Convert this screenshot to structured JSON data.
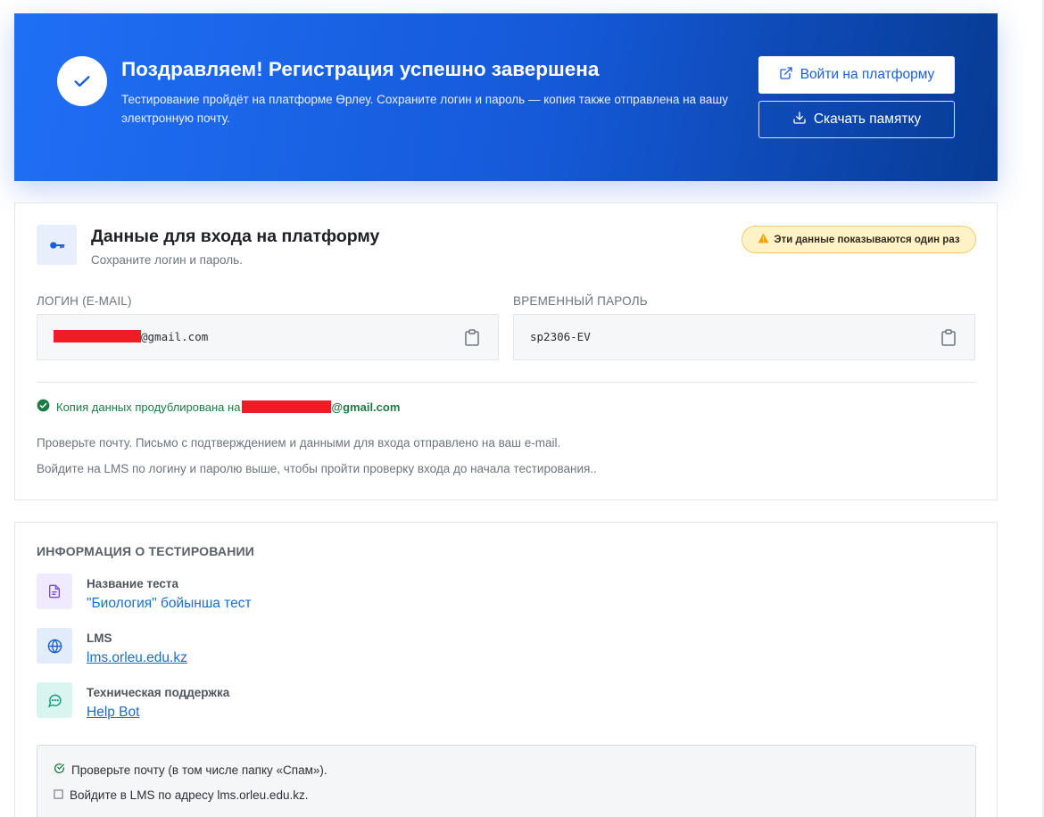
{
  "hero": {
    "title": "Поздравляем! Регистрация успешно завершена",
    "subtitle": "Тестирование пройдёт на платформе Өрлеу. Сохраните логин и пароль — копия также отправлена на вашу электронную почту.",
    "login_button": "Войти на платформу",
    "download_button": "Скачать памятку",
    "icons": {
      "check": "check-icon",
      "login": "external-link-icon",
      "download": "download-icon"
    }
  },
  "credentials": {
    "title": "Данные для входа на платформу",
    "subtitle": "Сохраните логин и пароль.",
    "warning": "Эти данные показываются один раз",
    "login_label": "ЛОГИН (E-MAIL)",
    "login_value_suffix": "@gmail.com",
    "password_label": "ВРЕМЕННЫЙ ПАРОЛЬ",
    "password_value": "sp2306-EV",
    "duplicate_text": "Копия данных продублирована на",
    "duplicate_email_suffix": "@gmail.com",
    "note1": "Проверьте почту. Письмо с подтверждением и данными для входа отправлено на ваш e-mail.",
    "note2": "Войдите на LMS по логину и паролю выше, чтобы пройти проверку входа до начала тестирования..",
    "icons": {
      "key": "key-icon",
      "copy": "clipboard-icon",
      "warning": "warning-icon",
      "ok": "check-circle-icon"
    }
  },
  "testing_info": {
    "heading": "ИНФОРМАЦИЯ О ТЕСТИРОВАНИИ",
    "items": [
      {
        "label": "Название теста",
        "value": "\"Биология\" бойынша тест",
        "icon": "document-icon"
      },
      {
        "label": "LMS",
        "value": "lms.orleu.edu.kz",
        "icon": "globe-icon"
      },
      {
        "label": "Техническая поддержка",
        "value": "Help Bot",
        "icon": "chat-icon"
      }
    ],
    "checklist": [
      {
        "text": "Проверьте почту (в том числе папку «Спам»).",
        "checked": true
      },
      {
        "text": "Войдите в LMS по адресу lms.orleu.edu.kz.",
        "checked": false
      }
    ]
  },
  "colors": {
    "hero_gradient_start": "#1f6ff5",
    "hero_gradient_end": "#073b94",
    "success": "#1c7a43",
    "link": "#1a6fc4",
    "warning_bg": "#fff2c7",
    "redaction": "#ee1c25"
  }
}
